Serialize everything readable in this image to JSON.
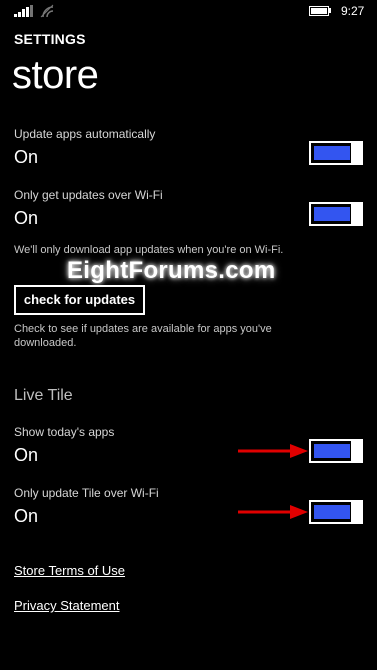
{
  "status_bar": {
    "time": "9:27",
    "icons": [
      "signal-icon",
      "wifi-icon",
      "battery-icon"
    ]
  },
  "header": {
    "kicker": "SETTINGS",
    "title": "store"
  },
  "settings": [
    {
      "label": "Update apps automatically",
      "state": "On",
      "toggle": "on"
    },
    {
      "label": "Only get updates over Wi-Fi",
      "state": "On",
      "toggle": "on"
    }
  ],
  "wifi_note": "We'll only download app updates when you're on Wi-Fi.",
  "watermark": "EightForums.com",
  "check_button_label": "check for updates",
  "check_note_line1": "Check to see if updates are available for apps you've",
  "check_note_line2": "downloaded.",
  "live_tile": {
    "section_title": "Live Tile",
    "settings": [
      {
        "label": "Show today's apps",
        "state": "On",
        "toggle": "on"
      },
      {
        "label": "Only update Tile over Wi-Fi",
        "state": "On",
        "toggle": "on"
      }
    ]
  },
  "links": {
    "terms": "Store Terms of Use",
    "privacy": "Privacy Statement"
  },
  "colors": {
    "background": "#000000",
    "toggle_on": "#3355f0",
    "annotation_arrow": "#e00000"
  }
}
